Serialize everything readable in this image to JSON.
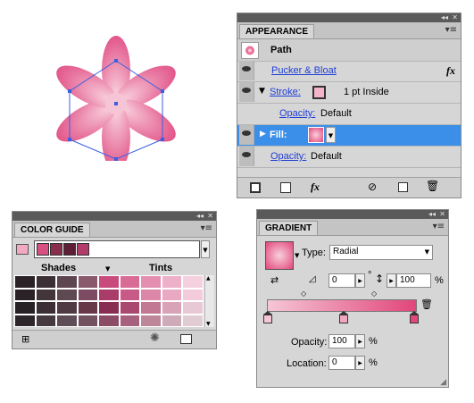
{
  "appearance": {
    "tab": "APPEARANCE",
    "header": "Path",
    "rows": {
      "effect": "Pucker & Bloat",
      "fx": "fx",
      "stroke_label": "Stroke:",
      "stroke_value": "1 pt  Inside",
      "stroke_opacity_label": "Opacity:",
      "stroke_opacity_value": "Default",
      "fill_label": "Fill:",
      "opacity_label": "Opacity:",
      "opacity_value": "Default"
    },
    "footer_fx": "fx"
  },
  "color_guide": {
    "tab": "COLOR GUIDE",
    "shades_label": "Shades",
    "tints_label": "Tints",
    "harmony_colors": [
      "#d85082",
      "#8a2d4d",
      "#5e1f36",
      "#b23c6a"
    ],
    "grid": [
      [
        "#2a2226",
        "#3c3036",
        "#5d4650",
        "#8a5a6c",
        "#c94b7e",
        "#d96c96",
        "#e58fb0",
        "#eeb0c8",
        "#f5d0de"
      ],
      [
        "#2a2226",
        "#42363b",
        "#5e4852",
        "#7e4c62",
        "#a93c68",
        "#c75a86",
        "#dc86a8",
        "#e9a9c2",
        "#f3cbda"
      ],
      [
        "#272125",
        "#3b2f35",
        "#4f3a44",
        "#673847",
        "#892e53",
        "#a9496f",
        "#c27893",
        "#d8a3b6",
        "#e8c8d4"
      ],
      [
        "#2c2529",
        "#463a40",
        "#5e4c56",
        "#73525f",
        "#8c4c66",
        "#a7607e",
        "#bd8699",
        "#cfaab8",
        "#e1ccd4"
      ]
    ]
  },
  "gradient": {
    "tab": "GRADIENT",
    "type_label": "Type:",
    "type_value": "Radial",
    "angle_value": "0",
    "degree_symbol": "°",
    "aspect_value": "100",
    "percent_symbol": "%",
    "opacity_label": "Opacity:",
    "opacity_value": "100",
    "location_label": "Location:",
    "location_value": "0",
    "colors": {
      "start": "#f5c6d6",
      "end": "#e2467a"
    }
  },
  "artwork": {
    "fill": "#e8729b",
    "fill_light": "#f7c3d4",
    "selection": "#3a5fe0"
  }
}
